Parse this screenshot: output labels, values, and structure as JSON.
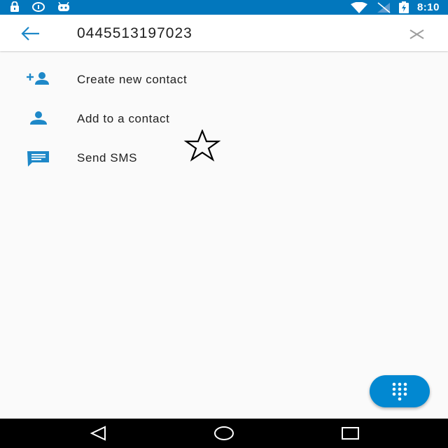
{
  "status_bar": {
    "time": "8:10",
    "icons_left": [
      "lock-icon",
      "info-circle-icon",
      "android-icon"
    ],
    "icons_right": [
      "wifi-icon",
      "no-signal-icon",
      "battery-charging-icon"
    ]
  },
  "header": {
    "search_value": "0445513197023",
    "back_icon": "arrow-left-icon",
    "clear_icon": "close-icon"
  },
  "actions": [
    {
      "label": "Create new contact",
      "icon": "person-add-icon"
    },
    {
      "label": "Add to a contact",
      "icon": "person-icon"
    },
    {
      "label": "Send SMS",
      "icon": "message-icon"
    }
  ],
  "overlay": {
    "icon": "star-outline-icon"
  },
  "fab": {
    "icon": "dialpad-icon"
  },
  "nav": {
    "back": "nav-back-icon",
    "home": "nav-home-icon",
    "recents": "nav-recents-icon"
  },
  "colors": {
    "status_bar": "#0277bd",
    "accent": "#0288d1",
    "icon_blue": "#1e88c8",
    "nav_bar": "#000000"
  }
}
